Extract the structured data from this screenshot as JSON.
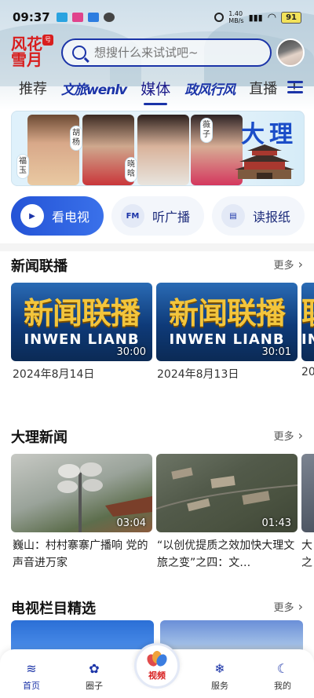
{
  "status": {
    "time": "09:37",
    "net_speed": "1.40\nMB/s",
    "battery": "91"
  },
  "header": {
    "logo": {
      "line1": "风花",
      "line2": "雪月",
      "mark": "号"
    },
    "search": {
      "placeholder": "想搜什么来试试吧~"
    }
  },
  "nav": {
    "tabs": [
      {
        "label": "推荐"
      },
      {
        "label": "文旅wenlv"
      },
      {
        "label": "媒体"
      },
      {
        "label": "政风行风"
      },
      {
        "label": "直播"
      },
      {
        "label": "!"
      }
    ],
    "active": "媒体"
  },
  "banner": {
    "title": "大理",
    "names": [
      "福玉",
      "胡杨",
      "晓晗",
      "薇子"
    ]
  },
  "quick_links": [
    {
      "label": "看电视",
      "icon": "tv-icon",
      "icon_text": "▶"
    },
    {
      "label": "听广播",
      "icon": "radio-icon",
      "icon_text": "FM"
    },
    {
      "label": "读报纸",
      "icon": "newspaper-icon",
      "icon_text": "▤"
    }
  ],
  "sections": {
    "xwlb": {
      "title": "新闻联播",
      "more": "更多",
      "items": [
        {
          "img_title": "新闻联播",
          "img_sub": "INWEN LIANB",
          "duration": "30:00",
          "date": "2024年8月14日"
        },
        {
          "img_title": "新闻联播",
          "img_sub": "INWEN LIANB",
          "duration": "30:01",
          "date": "2024年8月13日"
        },
        {
          "img_title": "联",
          "img_sub": "IN",
          "duration": "",
          "date": "20"
        }
      ]
    },
    "dlxw": {
      "title": "大理新闻",
      "more": "更多",
      "items": [
        {
          "duration": "03:04",
          "caption": "巍山：村村寨寨广播响 党的声音进万家"
        },
        {
          "duration": "01:43",
          "caption": "“以创优提质之效加快大理文旅之变”之四：文…"
        },
        {
          "duration": "",
          "caption": "大之"
        }
      ]
    },
    "dslm": {
      "title": "电视栏目精选",
      "more": "更多"
    }
  },
  "bottom_nav": [
    {
      "label": "首页",
      "icon": "home-icon"
    },
    {
      "label": "圈子",
      "icon": "circle-icon"
    },
    {
      "label": "视频",
      "icon": "video-flower-icon"
    },
    {
      "label": "服务",
      "icon": "service-icon"
    },
    {
      "label": "我的",
      "icon": "profile-icon"
    }
  ],
  "colors": {
    "accent": "#1b34a8",
    "brand_red": "#d81e1e"
  }
}
